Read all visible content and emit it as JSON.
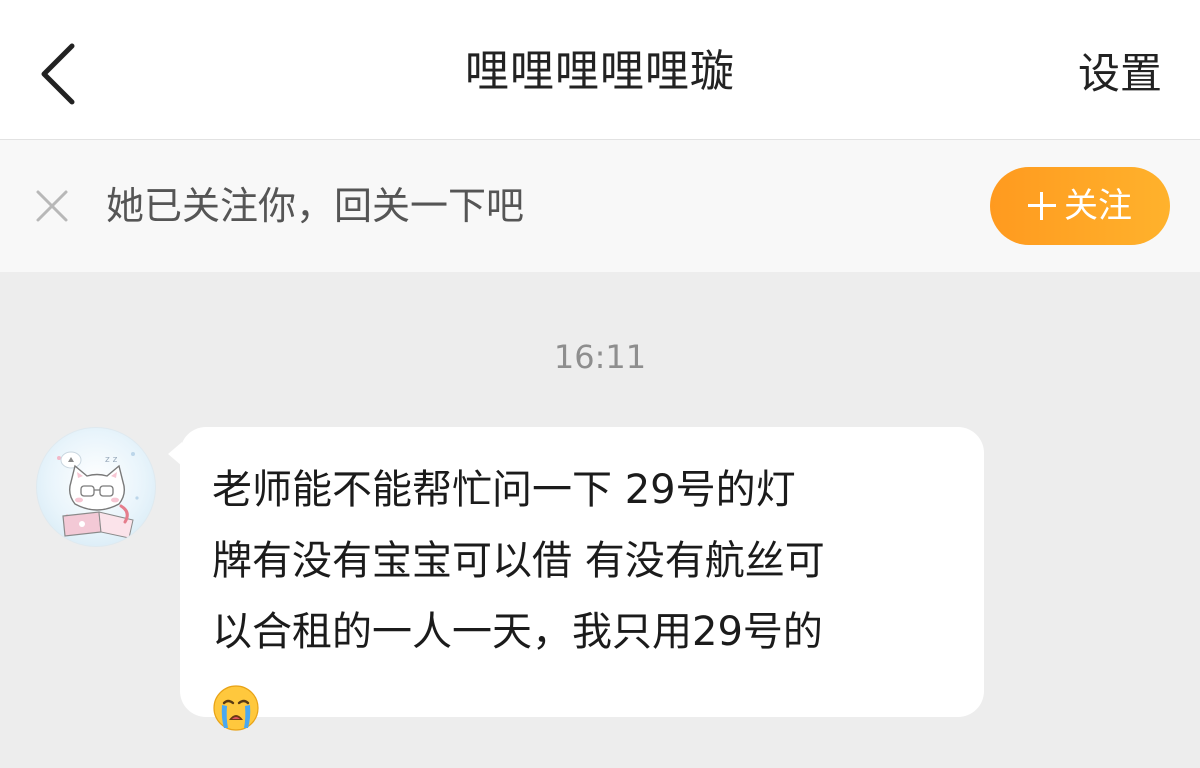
{
  "header": {
    "title": "哩哩哩哩哩璇",
    "settings_label": "设置",
    "back_icon": "chevron-left-icon"
  },
  "follow_bar": {
    "message": "她已关注你，回关一下吧",
    "button_label": "关注",
    "close_icon": "close-icon",
    "plus_icon": "plus-icon",
    "button_color": "#ffa424"
  },
  "chat": {
    "timestamp": "16:11",
    "messages": [
      {
        "sender": "other",
        "avatar_icon": "cat-avatar",
        "lines": [
          "老师能不能帮忙问一下 29号的灯",
          "牌有没有宝宝可以借 有没有航丝可",
          "以合租的一人一天，我只用29号的"
        ],
        "emoji": "crying-face-emoji"
      }
    ]
  }
}
